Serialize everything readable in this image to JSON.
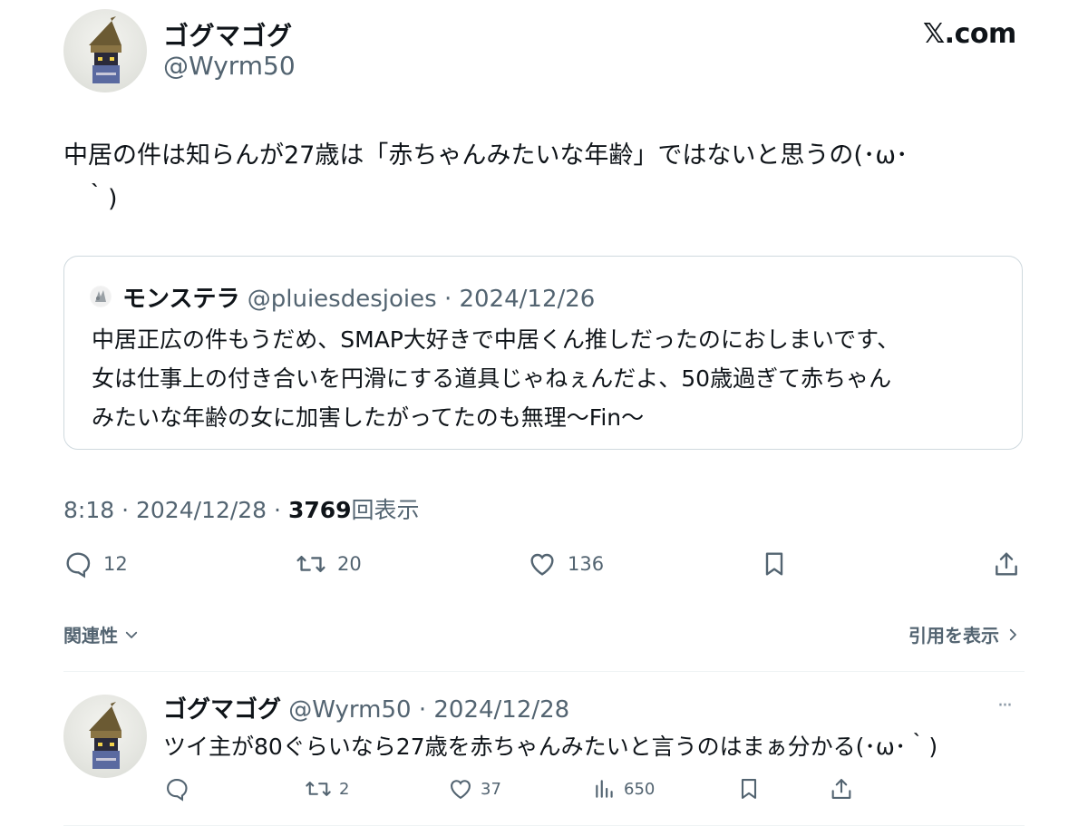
{
  "author": {
    "name": "ゴグマゴグ",
    "handle": "@Wyrm50"
  },
  "brand": {
    "logo_text": "𝕏.com"
  },
  "tweet": {
    "text_line1": "中居の件は知らんが27歳は「赤ちゃんみたいな年齢」ではないと思うの(･ω･",
    "text_line2": "｀)"
  },
  "quote": {
    "name": "モンステラ",
    "handle": "@pluiesdesjoies",
    "dot": "·",
    "date": "2024/12/26",
    "lines": [
      "中居正広の件もうだめ、SMAP大好きで中居くん推しだったのにおしまいです、",
      "女は仕事上の付き合いを円滑にする道具じゃねぇんだよ、50歳過ぎて赤ちゃん",
      "みたいな年齢の女に加害したがってたのも無理〜Fin〜"
    ]
  },
  "meta": {
    "time": "8:18",
    "sep": "·",
    "date": "2024/12/28",
    "views": "3769",
    "views_label": "回表示"
  },
  "actions": {
    "replies": "12",
    "retweets": "20",
    "likes": "136"
  },
  "links": {
    "relevance": "関連性",
    "view_quotes": "引用を表示"
  },
  "reply": {
    "name": "ゴグマゴグ",
    "handle": "@Wyrm50",
    "dot": "·",
    "date": "2024/12/28",
    "text": "ツイ主が80ぐらいなら27歳を赤ちゃんみたいと言うのはまぁ分かる(･ω･｀)",
    "more": "···",
    "retweets": "2",
    "likes": "37",
    "views": "650"
  },
  "colors": {
    "text": "#0f1419",
    "secondary": "#536471",
    "border": "#cfd9de"
  }
}
